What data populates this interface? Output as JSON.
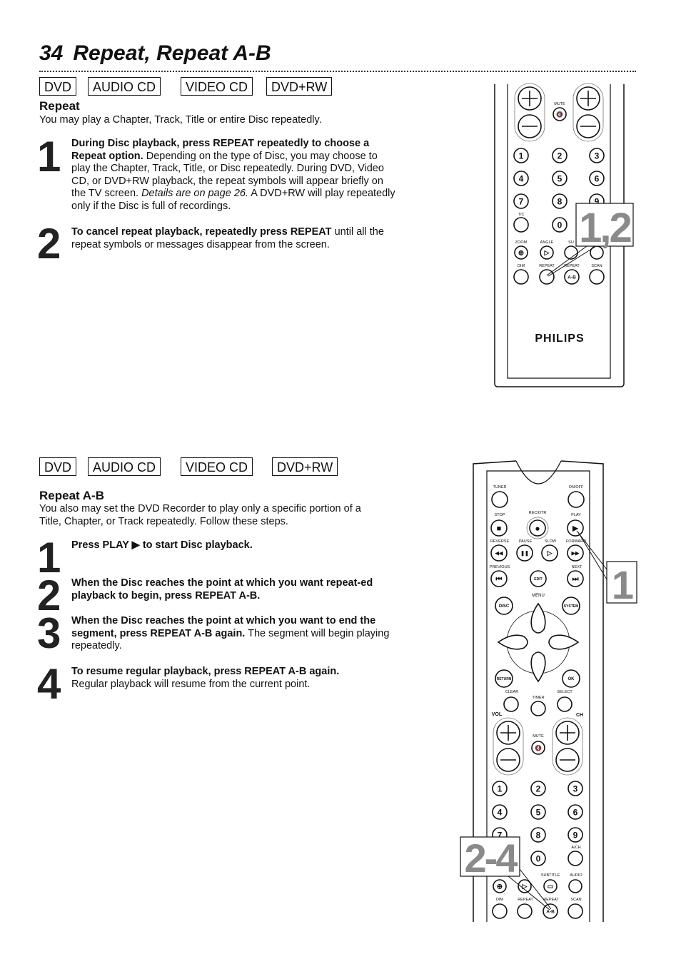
{
  "page": {
    "number": "34",
    "title": "Repeat, Repeat A-B"
  },
  "section1": {
    "badges": [
      "DVD",
      "AUDIO CD",
      "VIDEO CD",
      "DVD+RW"
    ],
    "heading": "Repeat",
    "intro": "You may play a Chapter, Track, Title or entire Disc repeatedly.",
    "steps": [
      {
        "num": "1",
        "bold": "During Disc playback, press REPEAT repeatedly to choose a Repeat option.",
        "text": " Depending on the type of Disc, you may choose to play the Chapter, Track, Title, or Disc repeatedly. During DVD, Video CD, or DVD+RW playback, the repeat symbols will appear briefly on the TV screen. ",
        "italic": "Details are on page 26.",
        "text2": " A DVD+RW will play repeatedly only if the Disc is full of recordings."
      },
      {
        "num": "2",
        "bold": "To cancel repeat playback, repeatedly press REPEAT",
        "text": " until all the repeat symbols or messages disappear from the screen."
      }
    ]
  },
  "section2": {
    "badges": [
      "DVD",
      "AUDIO CD",
      "VIDEO CD",
      "DVD+RW"
    ],
    "heading": "Repeat A-B",
    "intro": "You also may set the DVD Recorder to play only a specific portion of a Title, Chapter, or Track repeatedly. Follow these steps.",
    "steps": [
      {
        "num": "1",
        "bold": "Press PLAY ▶ to start Disc playback.",
        "text": ""
      },
      {
        "num": "2",
        "bold": "When the Disc reaches the point at which you want repeat-ed playback to begin, press REPEAT A-B.",
        "text": ""
      },
      {
        "num": "3",
        "bold": "When the Disc reaches the point at which you want to end the segment, press REPEAT A-B again.",
        "text": " The segment will begin playing repeatedly."
      },
      {
        "num": "4",
        "bold": "To resume regular playback, press REPEAT A-B again.",
        "text": " Regular playback will resume from the current point."
      }
    ]
  },
  "remote1": {
    "brand": "PHILIPS",
    "callout": "1,2",
    "labels": {
      "mute": "MUTE",
      "tc": "T/C",
      "zoom": "ZOOM",
      "angle": "ANGLE",
      "subtitle": "SU",
      "dim": "DIM",
      "repeat": "REPEAT",
      "repeat_ab": "REPEAT",
      "scan": "SCAN",
      "ab": "A-B"
    },
    "digits": [
      "1",
      "2",
      "3",
      "4",
      "5",
      "6",
      "7",
      "8",
      "9",
      "0"
    ]
  },
  "remote2": {
    "callout_1": "1",
    "callout_2": "2-4",
    "labels": {
      "tuner": "TUNER",
      "onoff": "ON/OFF",
      "stop": "STOP",
      "rec": "REC/OTR",
      "play": "PLAY",
      "reverse": "REVERSE",
      "pause": "PAUSE",
      "slow": "SLOW",
      "forward": "FORWARD",
      "previous": "PREVIOUS",
      "next": "NEXT",
      "edit": "EDIT",
      "disc": "DISC",
      "menu": "MENU",
      "system": "SYSTEM",
      "return": "RETURN",
      "ok": "OK",
      "clear": "CLEAR",
      "timer": "TIMER",
      "select": "SELECT",
      "vol": "VOL",
      "ch": "CH",
      "mute": "MUTE",
      "ach": "A/CH",
      "subtitle": "SUBTITLE",
      "audio": "AUDIO",
      "dim": "DIM",
      "repeat": "REPEAT",
      "repeat_ab": "REPEAT",
      "scan": "SCAN",
      "ab": "A-B"
    },
    "digits": [
      "1",
      "2",
      "3",
      "4",
      "5",
      "6",
      "7",
      "8",
      "9",
      "0"
    ]
  },
  "colors": {
    "callout_text": "#8a8a8a",
    "ink": "#111111"
  }
}
